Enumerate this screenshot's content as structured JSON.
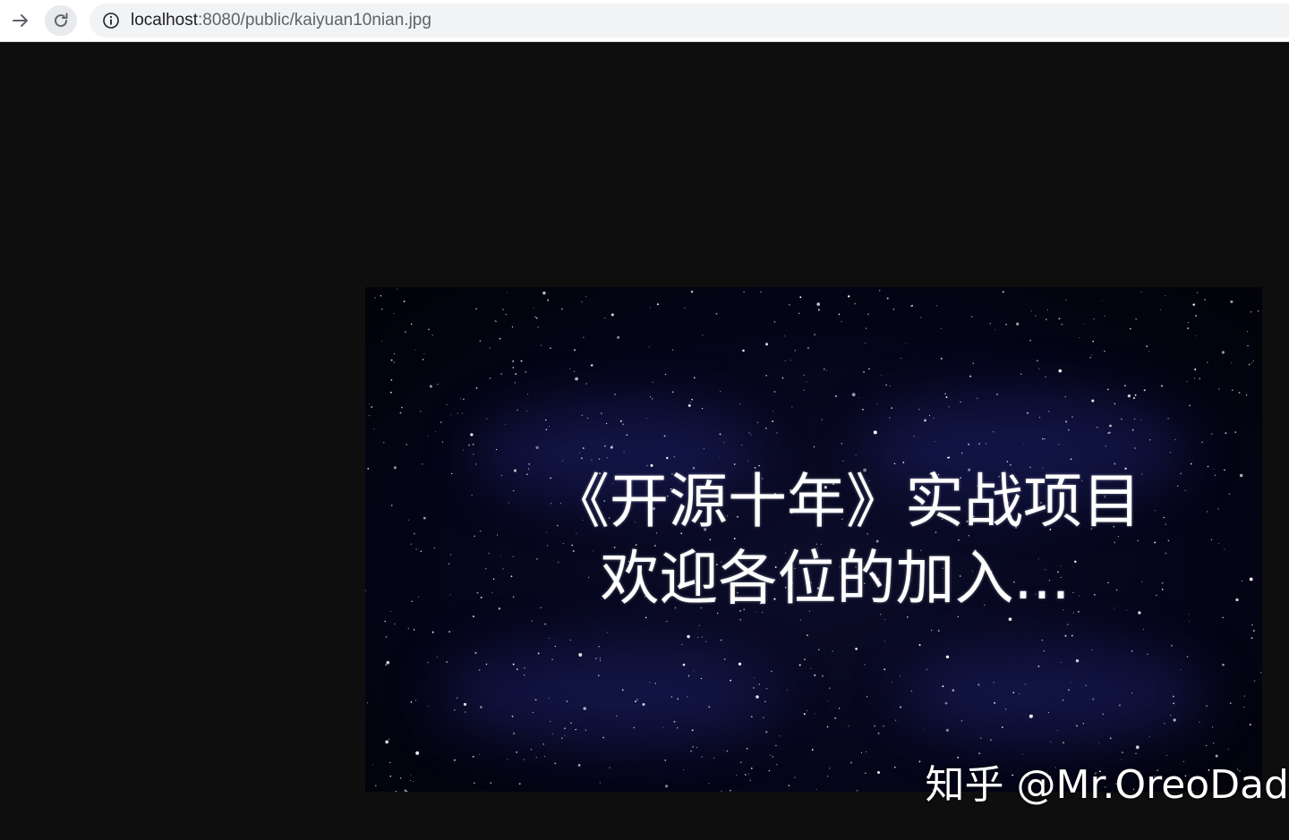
{
  "browser": {
    "url_host": "localhost",
    "url_path": ":8080/public/kaiyuan10nian.jpg",
    "icons": {
      "forward": "arrow-right-icon",
      "reload": "reload-icon",
      "info": "info-icon"
    }
  },
  "image": {
    "headline_line1": "《开源十年》实战项目",
    "headline_line2": "欢迎各位的加入...",
    "watermark": "知乎 @Mr.OreoDad",
    "colors": {
      "background": "#0e0e0e",
      "sky": "#05051a",
      "text": "#ffffff"
    }
  }
}
